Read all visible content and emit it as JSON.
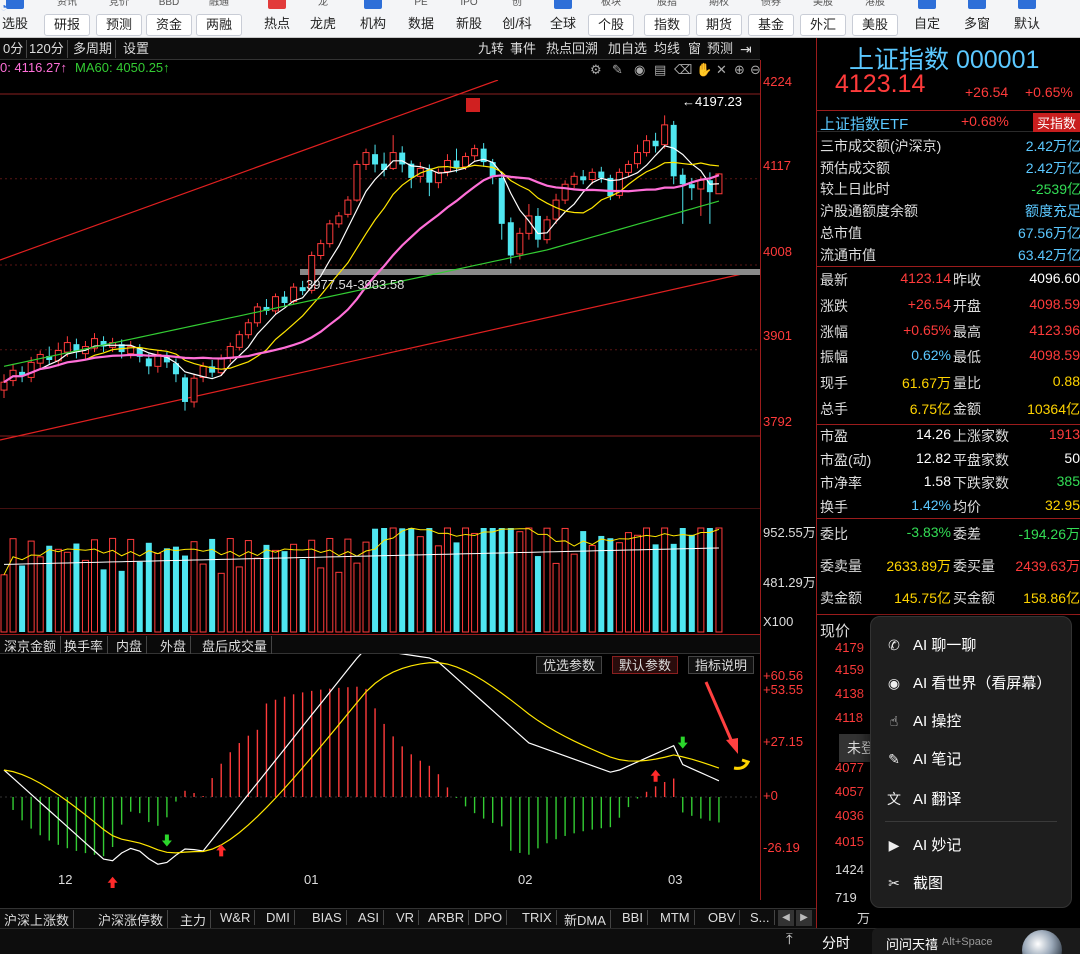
{
  "toolbar": {
    "items": [
      {
        "top": "",
        "label": "选股"
      },
      {
        "top": "资讯",
        "label": "研报"
      },
      {
        "top": "竞价",
        "label": "预测"
      },
      {
        "top": "BBD",
        "label": "资金"
      },
      {
        "top": "融通",
        "label": "两融"
      },
      {
        "top": "",
        "label": "热点"
      },
      {
        "top": "龙",
        "label": "龙虎"
      },
      {
        "top": "",
        "label": "机构"
      },
      {
        "top": "PE",
        "label": "数据"
      },
      {
        "top": "IPO",
        "label": "新股"
      },
      {
        "top": "创",
        "label": "创/科"
      },
      {
        "top": "",
        "label": "全球"
      },
      {
        "top": "板块",
        "label": "个股"
      },
      {
        "top": "股指",
        "label": "指数"
      },
      {
        "top": "期权",
        "label": "期货"
      },
      {
        "top": "债券",
        "label": "基金"
      },
      {
        "top": "美股",
        "label": "外汇"
      },
      {
        "top": "港股",
        "label": "美股"
      },
      {
        "top": "",
        "label": "自定"
      },
      {
        "top": "",
        "label": "多窗"
      },
      {
        "top": "",
        "label": "默认"
      }
    ]
  },
  "chart_tabs": {
    "left": [
      "0分",
      "120分",
      "多周期",
      "设置"
    ],
    "right": [
      "九转",
      "事件",
      "热点回溯",
      "加自选",
      "均线",
      "窗",
      "预测"
    ]
  },
  "ma": {
    "ma30": "0: 4116.27↑",
    "ma60": "MA60: 4050.25↑"
  },
  "chart_annotations": {
    "high": "4197.23",
    "gap": "3977.54-3983.58"
  },
  "price_axis": [
    "4224",
    "4117",
    "4008",
    "3901",
    "3792"
  ],
  "vol_axis": [
    "952.55万",
    "481.29万",
    "X100"
  ],
  "macd_axis": [
    "+60.56",
    "+53.55",
    "+27.15",
    "+0",
    "-26.19"
  ],
  "indicator_tabs": [
    "深京金额",
    "换手率",
    "内盘",
    "外盘",
    "盘后成交量"
  ],
  "macd_buttons": [
    "优选参数",
    "默认参数",
    "指标说明"
  ],
  "date_labels": [
    "12",
    "01",
    "02",
    "03"
  ],
  "bottom_tabs": [
    "沪深上涨数",
    "沪深涨停数",
    "主力",
    "W&R",
    "DMI",
    "BIAS",
    "ASI",
    "VR",
    "ARBR",
    "DPO",
    "TRIX",
    "新DMA",
    "BBI",
    "MTM",
    "OBV",
    "S..."
  ],
  "quote": {
    "name": "上证指数",
    "code": "000001",
    "price": "4123.14",
    "change": "+26.54",
    "pct": "+0.65%",
    "etf_label": "上证指数ETF",
    "etf_pct": "+0.68%",
    "buy_index": "买指数",
    "stats": [
      {
        "k": "三市成交额(沪深京)",
        "v": "2.42万亿",
        "c": "cyan"
      },
      {
        "k": "预估成交额",
        "v": "2.42万亿",
        "c": "cyan"
      },
      {
        "k": "较上日此时",
        "v": "-2539亿",
        "c": "green"
      },
      {
        "k": "沪股通额度余额",
        "v": "额度充足",
        "c": "cyan"
      },
      {
        "k": "总市值",
        "v": "67.56万亿",
        "c": "cyan"
      },
      {
        "k": "流通市值",
        "v": "63.42万亿",
        "c": "cyan"
      }
    ],
    "grid1": [
      [
        "最新",
        "4123.14",
        "red",
        "昨收",
        "4096.60",
        "white"
      ],
      [
        "涨跌",
        "+26.54",
        "red",
        "开盘",
        "4098.59",
        "red"
      ],
      [
        "涨幅",
        "+0.65%",
        "red",
        "最高",
        "4123.96",
        "red"
      ],
      [
        "振幅",
        "0.62%",
        "cyan",
        "最低",
        "4098.59",
        "red"
      ],
      [
        "现手",
        "61.67万",
        "yellow",
        "量比",
        "0.88",
        "yellow"
      ],
      [
        "总手",
        "6.75亿",
        "yellow",
        "金额",
        "10364亿",
        "yellow"
      ]
    ],
    "grid2": [
      [
        "市盈",
        "14.26",
        "white",
        "上涨家数",
        "1913",
        "red"
      ],
      [
        "市盈(动)",
        "12.82",
        "white",
        "平盘家数",
        "50",
        "white"
      ],
      [
        "市净率",
        "1.58",
        "white",
        "下跌家数",
        "385",
        "green"
      ],
      [
        "换手",
        "1.42%",
        "cyan",
        "均价",
        "32.95",
        "yellow"
      ]
    ],
    "grid3": [
      [
        "委比",
        "-3.83%",
        "green",
        "委差",
        "-194.26万",
        "green"
      ],
      [
        "委卖量",
        "2633.89万",
        "yellow",
        "委买量",
        "2439.63万",
        "red"
      ],
      [
        "卖金额",
        "145.75亿",
        "yellow",
        "买金额",
        "158.86亿",
        "yellow"
      ]
    ],
    "now_price_label": "现价",
    "tick_prices": [
      "4179",
      "4159",
      "4138",
      "4118",
      "4077",
      "4057",
      "4036",
      "4015",
      "1424",
      "719"
    ],
    "tick_unit": "万",
    "unlogged": "未登",
    "tabs_bottom": "分时"
  },
  "ai_menu": {
    "items": [
      {
        "icon": "phone-icon",
        "glyph": "✆",
        "label": "AI 聊一聊"
      },
      {
        "icon": "eye-icon",
        "glyph": "◉",
        "label": "AI 看世界（看屏幕）"
      },
      {
        "icon": "control-icon",
        "glyph": "☝",
        "label": "AI 操控"
      },
      {
        "icon": "note-icon",
        "glyph": "✎",
        "label": "AI 笔记"
      },
      {
        "icon": "translate-icon",
        "glyph": "文",
        "label": "AI 翻译"
      },
      {
        "icon": "camera-icon",
        "glyph": "▶",
        "label": "AI 妙记"
      },
      {
        "icon": "scissors-icon",
        "glyph": "✂",
        "label": "截图"
      }
    ],
    "ask_label": "问问天禧",
    "ask_shortcut": "Alt+Space"
  },
  "colors": {
    "up": "#ff3b3b",
    "down": "#4fe6f0",
    "ma5": "#ffffff",
    "ma10": "#ffe600",
    "ma20": "#ff6fd8",
    "ma60": "#33cc33",
    "accent": "#5bc8ff"
  }
}
